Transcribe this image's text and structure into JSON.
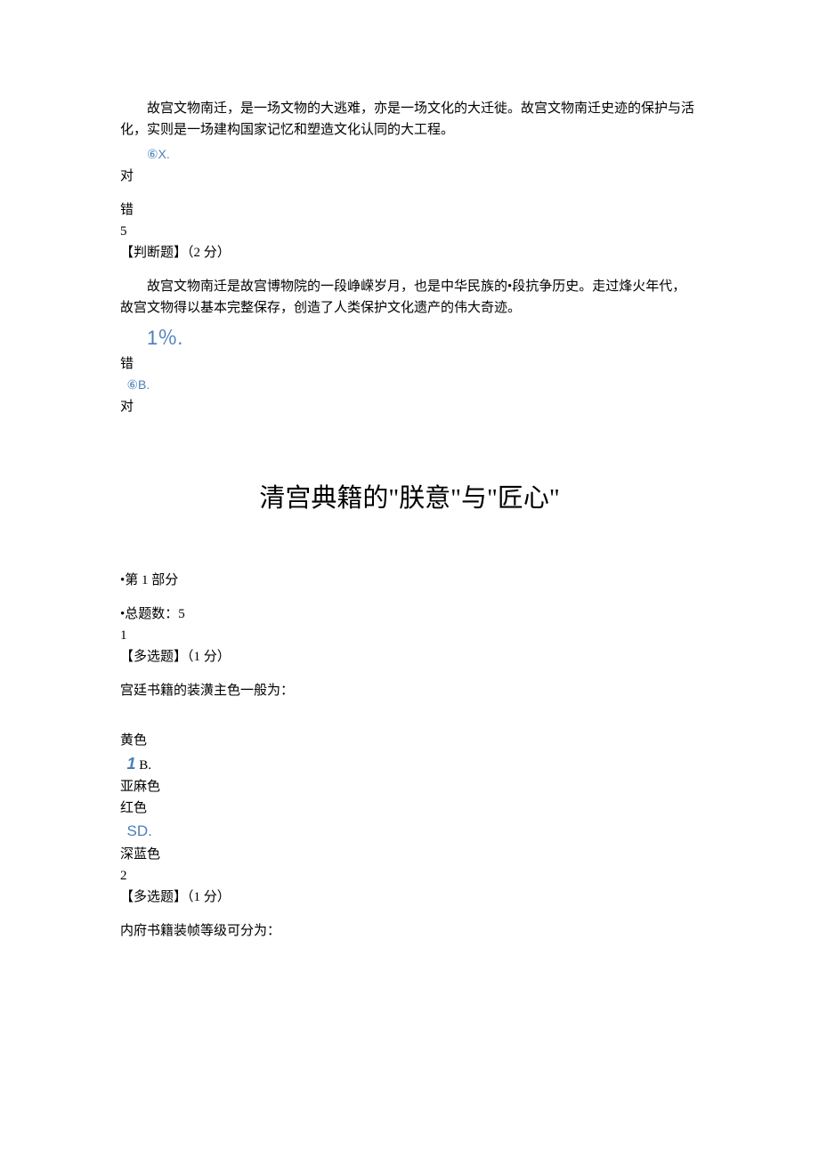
{
  "q4": {
    "passage": "故宫文物南迁，是一场文物的大逃难，亦是一场文化的大迁徙。故宫文物南迁史迹的保护与活化，实则是一场建构国家记忆和塑造文化认同的大工程。",
    "marker": "⑥X.",
    "opt_a": "对",
    "opt_b": "错"
  },
  "q5": {
    "number": "5",
    "type_line": "【判断题】（2 分）",
    "passage": "故宫文物南迁是故宫博物院的一段峥嵘岁月，也是中华民族的•段抗争历史。走过烽火年代，故宫文物得以基本完整保存，创造了人类保护文化遗产的伟大奇迹。",
    "marker_a": "1％.",
    "opt_a": "错",
    "marker_b": "⑥B.",
    "opt_b": "对"
  },
  "section_title": "清宫典籍的\"朕意\"与\"匠心\"",
  "part_label": "•第 1 部分",
  "count_label": "•总题数：5",
  "s1": {
    "number": "1",
    "type_line": "【多选题】（1 分）",
    "stem": "宫廷书籍的装潢主色一般为：",
    "opt_a": "黄色",
    "marker_b": "1",
    "marker_b_suffix": " B.",
    "opt_b": "亚麻色",
    "opt_c": "红色",
    "marker_d": "SD.",
    "opt_d": "深蓝色"
  },
  "s2": {
    "number": "2",
    "type_line": "【多选题】（1 分）",
    "stem": "内府书籍装帧等级可分为："
  }
}
